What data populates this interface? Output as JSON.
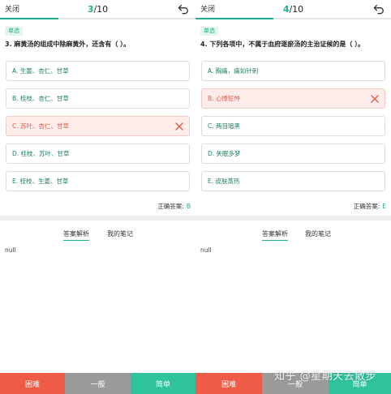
{
  "left": {
    "close_label": "关闭",
    "progress_current": "3",
    "progress_total": "/10",
    "progress_fraction": 0.3,
    "question_type": "单选",
    "question": "3. 麻黄汤的组成中除麻黄外，还含有（    ）。",
    "options": [
      {
        "label": "A. 生姜、杏仁、甘草",
        "state": "normal"
      },
      {
        "label": "B. 桂枝、杏仁、甘草",
        "state": "normal"
      },
      {
        "label": "C. 苏叶、杏仁、甘草",
        "state": "wrong"
      },
      {
        "label": "D. 桂枝、苏叶、甘草",
        "state": "normal"
      },
      {
        "label": "E. 桂枝、生姜、甘草",
        "state": "normal"
      }
    ],
    "answer_label": "正确答案:",
    "answer_value": "B",
    "tabs": [
      "答案解析",
      "我的笔记"
    ],
    "analysis": "null"
  },
  "right": {
    "close_label": "关闭",
    "progress_current": "4",
    "progress_total": "/10",
    "progress_fraction": 0.4,
    "question_type": "单选",
    "question": "4. 下列各项中，不属于血府逐瘀汤的主治证候的是（    ）。",
    "options": [
      {
        "label": "A. 胸痛，痛如针刺",
        "state": "normal"
      },
      {
        "label": "B. 心悸怔忡",
        "state": "wrong"
      },
      {
        "label": "C. 两目暗黑",
        "state": "normal"
      },
      {
        "label": "D. 失眠多梦",
        "state": "normal"
      },
      {
        "label": "E. 皮肤蒸热",
        "state": "normal"
      }
    ],
    "answer_label": "正确答案:",
    "answer_value": "E",
    "tabs": [
      "答案解析",
      "我的笔记"
    ],
    "analysis": "null"
  },
  "bottom_buttons": [
    "困难",
    "一般",
    "简单",
    "困难",
    "一般",
    "简单"
  ],
  "watermark": "知乎 @星期天去散步",
  "colors": {
    "accent": "#1fb08f",
    "wrong": "#e25a48",
    "wrong_bg": "#fdecea",
    "hard": "#ee5b47",
    "normal": "#9b9b9b",
    "easy": "#2ec39b"
  },
  "icons": {
    "undo": "undo-icon",
    "wrong": "close-icon"
  }
}
